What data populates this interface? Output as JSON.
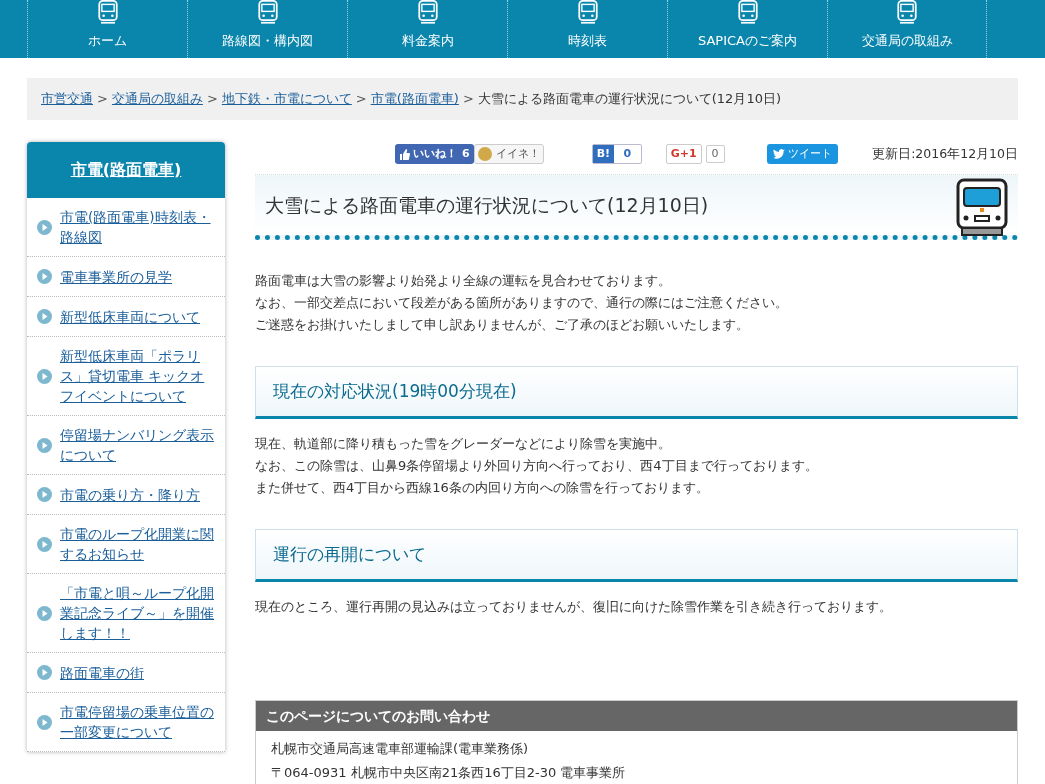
{
  "nav": [
    {
      "label": "ホーム"
    },
    {
      "label": "路線図・構内図"
    },
    {
      "label": "料金案内"
    },
    {
      "label": "時刻表"
    },
    {
      "label": "SAPICAのご案内"
    },
    {
      "label": "交通局の取組み"
    }
  ],
  "breadcrumb": {
    "links": [
      "市営交通",
      "交通局の取組み",
      "地下鉄・市電について",
      "市電(路面電車)"
    ],
    "separator": ">",
    "current": "大雪による路面電車の運行状況について(12月10日)"
  },
  "sidebar": {
    "title": "市電(路面電車)",
    "items": [
      "市電(路面電車)時刻表・路線図",
      "電車事業所の見学",
      "新型低床車両について",
      "新型低床車両「ポラリス」貸切電車 キックオフイベントについて",
      "停留場ナンバリング表示について",
      "市電の乗り方・降り方",
      "市電のループ化開業に関するお知らせ",
      "「市電と唄～ループ化開業記念ライブ～」を開催します！！",
      "路面電車の街",
      "市電停留場の乗車位置の一部変更について"
    ]
  },
  "social": {
    "like": "いいね！",
    "like_count": "6",
    "mixi": "イイネ！",
    "hatena": "B!",
    "hatena_count": "0",
    "gplus": "G+1",
    "gplus_count": "0",
    "tweet": "ツイート"
  },
  "updated": "更新日:2016年12月10日",
  "title": "大雪による路面電車の運行状況について(12月10日)",
  "intro": [
    "路面電車は大雪の影響より始発より全線の運転を見合わせております。",
    "なお、一部交差点において段差がある箇所がありますので、通行の際にはご注意ください。",
    "ご迷惑をお掛けいたしまして申し訳ありませんが、ご了承のほどお願いいたします。"
  ],
  "sections": [
    {
      "heading": "現在の対応状況(19時00分現在)",
      "paragraphs": [
        "現在、軌道部に降り積もった雪をグレーダーなどにより除雪を実施中。",
        "なお、この除雪は、山鼻9条停留場より外回り方向へ行っており、西4丁目まで行っております。",
        "また併せて、西4丁目から西線16条の内回り方向への除雪を行っております。"
      ]
    },
    {
      "heading": "運行の再開について",
      "paragraphs": [
        "現在のところ、運行再開の見込みは立っておりませんが、復旧に向けた除雪作業を引き続き行っております。"
      ]
    }
  ],
  "contact": {
    "title": "このページについてのお問い合わせ",
    "lines": [
      "札幌市交通局高速電車部運輸課(電車業務係)",
      "〒064-0931 札幌市中央区南21条西16丁目2-30 電車事業所"
    ]
  }
}
